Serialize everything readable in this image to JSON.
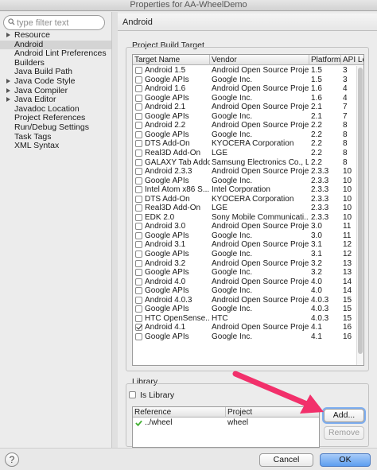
{
  "window": {
    "title": "Properties for AA-WheelDemo"
  },
  "filter": {
    "placeholder": "type filter text"
  },
  "tree": [
    {
      "label": "Resource",
      "expandable": true,
      "selected": false
    },
    {
      "label": "Android",
      "expandable": false,
      "selected": true
    },
    {
      "label": "Android Lint Preferences",
      "expandable": false,
      "selected": false
    },
    {
      "label": "Builders",
      "expandable": false,
      "selected": false
    },
    {
      "label": "Java Build Path",
      "expandable": false,
      "selected": false
    },
    {
      "label": "Java Code Style",
      "expandable": true,
      "selected": false
    },
    {
      "label": "Java Compiler",
      "expandable": true,
      "selected": false
    },
    {
      "label": "Java Editor",
      "expandable": true,
      "selected": false
    },
    {
      "label": "Javadoc Location",
      "expandable": false,
      "selected": false
    },
    {
      "label": "Project References",
      "expandable": false,
      "selected": false
    },
    {
      "label": "Run/Debug Settings",
      "expandable": false,
      "selected": false
    },
    {
      "label": "Task Tags",
      "expandable": false,
      "selected": false
    },
    {
      "label": "XML Syntax",
      "expandable": false,
      "selected": false
    }
  ],
  "page": {
    "title": "Android"
  },
  "build_target": {
    "group_label": "Project Build Target",
    "columns": [
      "Target Name",
      "Vendor",
      "Platform",
      "API Le"
    ],
    "rows": [
      {
        "name": "Android 1.5",
        "vendor": "Android Open Source Project",
        "platform": "1.5",
        "api": "3",
        "checked": false
      },
      {
        "name": "Google APIs",
        "vendor": "Google Inc.",
        "platform": "1.5",
        "api": "3",
        "checked": false
      },
      {
        "name": "Android 1.6",
        "vendor": "Android Open Source Project",
        "platform": "1.6",
        "api": "4",
        "checked": false
      },
      {
        "name": "Google APIs",
        "vendor": "Google Inc.",
        "platform": "1.6",
        "api": "4",
        "checked": false
      },
      {
        "name": "Android 2.1",
        "vendor": "Android Open Source Project",
        "platform": "2.1",
        "api": "7",
        "checked": false
      },
      {
        "name": "Google APIs",
        "vendor": "Google Inc.",
        "platform": "2.1",
        "api": "7",
        "checked": false
      },
      {
        "name": "Android 2.2",
        "vendor": "Android Open Source Project",
        "platform": "2.2",
        "api": "8",
        "checked": false
      },
      {
        "name": "Google APIs",
        "vendor": "Google Inc.",
        "platform": "2.2",
        "api": "8",
        "checked": false
      },
      {
        "name": "DTS Add-On",
        "vendor": "KYOCERA Corporation",
        "platform": "2.2",
        "api": "8",
        "checked": false
      },
      {
        "name": "Real3D Add-On",
        "vendor": "LGE",
        "platform": "2.2",
        "api": "8",
        "checked": false
      },
      {
        "name": "GALAXY Tab Addon",
        "vendor": "Samsung Electronics Co., Ltd.",
        "platform": "2.2",
        "api": "8",
        "checked": false
      },
      {
        "name": "Android 2.3.3",
        "vendor": "Android Open Source Project",
        "platform": "2.3.3",
        "api": "10",
        "checked": false
      },
      {
        "name": "Google APIs",
        "vendor": "Google Inc.",
        "platform": "2.3.3",
        "api": "10",
        "checked": false
      },
      {
        "name": "Intel Atom x86 S...",
        "vendor": "Intel Corporation",
        "platform": "2.3.3",
        "api": "10",
        "checked": false
      },
      {
        "name": "DTS Add-On",
        "vendor": "KYOCERA Corporation",
        "platform": "2.3.3",
        "api": "10",
        "checked": false
      },
      {
        "name": "Real3D Add-On",
        "vendor": "LGE",
        "platform": "2.3.3",
        "api": "10",
        "checked": false
      },
      {
        "name": "EDK 2.0",
        "vendor": "Sony Mobile Communicati...",
        "platform": "2.3.3",
        "api": "10",
        "checked": false
      },
      {
        "name": "Android 3.0",
        "vendor": "Android Open Source Project",
        "platform": "3.0",
        "api": "11",
        "checked": false
      },
      {
        "name": "Google APIs",
        "vendor": "Google Inc.",
        "platform": "3.0",
        "api": "11",
        "checked": false
      },
      {
        "name": "Android 3.1",
        "vendor": "Android Open Source Project",
        "platform": "3.1",
        "api": "12",
        "checked": false
      },
      {
        "name": "Google APIs",
        "vendor": "Google Inc.",
        "platform": "3.1",
        "api": "12",
        "checked": false
      },
      {
        "name": "Android 3.2",
        "vendor": "Android Open Source Project",
        "platform": "3.2",
        "api": "13",
        "checked": false
      },
      {
        "name": "Google APIs",
        "vendor": "Google Inc.",
        "platform": "3.2",
        "api": "13",
        "checked": false
      },
      {
        "name": "Android 4.0",
        "vendor": "Android Open Source Project",
        "platform": "4.0",
        "api": "14",
        "checked": false
      },
      {
        "name": "Google APIs",
        "vendor": "Google Inc.",
        "platform": "4.0",
        "api": "14",
        "checked": false
      },
      {
        "name": "Android 4.0.3",
        "vendor": "Android Open Source Project",
        "platform": "4.0.3",
        "api": "15",
        "checked": false
      },
      {
        "name": "Google APIs",
        "vendor": "Google Inc.",
        "platform": "4.0.3",
        "api": "15",
        "checked": false
      },
      {
        "name": "HTC OpenSense...",
        "vendor": "HTC",
        "platform": "4.0.3",
        "api": "15",
        "checked": false
      },
      {
        "name": "Android 4.1",
        "vendor": "Android Open Source Project",
        "platform": "4.1",
        "api": "16",
        "checked": true
      },
      {
        "name": "Google APIs",
        "vendor": "Google Inc.",
        "platform": "4.1",
        "api": "16",
        "checked": false
      }
    ]
  },
  "library": {
    "group_label": "Library",
    "is_library_label": "Is Library",
    "is_library_checked": false,
    "columns": [
      "Reference",
      "Project"
    ],
    "rows": [
      {
        "reference": "../wheel",
        "project": "wheel",
        "status": "ok"
      }
    ],
    "add_label": "Add...",
    "remove_label": "Remove"
  },
  "footer": {
    "help_label": "?",
    "cancel_label": "Cancel",
    "ok_label": "OK"
  },
  "colors": {
    "annotation_arrow": "#f2306b",
    "ok_button": "#5e9ef0",
    "status_ok": "#3fae2e"
  },
  "icons": {
    "filter": "magnifier-icon",
    "status_ok": "green-checkmark-icon",
    "help": "help-icon"
  }
}
